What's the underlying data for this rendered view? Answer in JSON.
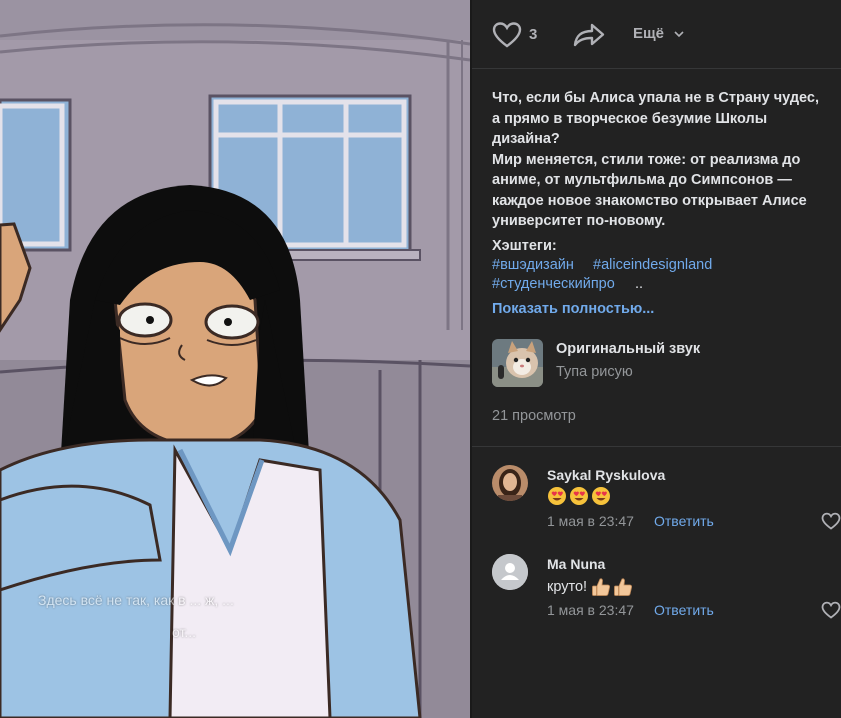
{
  "video": {
    "subtitle_line1": "Здесь всё не так, как в ... ж, ...",
    "subtitle_line2": "от..."
  },
  "actions": {
    "like_count": "3",
    "more_label": "Ещё",
    "icons": [
      "heart-outline-icon",
      "share-arrow-icon",
      "chevron-down-icon"
    ]
  },
  "post": {
    "description": [
      "Что, если бы Алиса упала не в Страну чудес,",
      "а прямо в творческое безумие Школы",
      "дизайна?",
      "Мир меняется, стили тоже: от реализма до",
      "аниме, от мультфильма до Симпсонов —",
      "каждое новое знакомство открывает Алисе",
      "университет по-новому."
    ],
    "hashtags_label": "Хэштеги:",
    "hashtags": [
      "#вшэдизайн",
      "#aliceindesignland",
      "#студенческийпро"
    ],
    "hashtags_ellipsis": "..",
    "show_more": "Показать полностью..."
  },
  "sound": {
    "title": "Оригинальный звук",
    "author": "Тупа рисую"
  },
  "views": "21 просмотр",
  "comments": [
    {
      "author": "Saykal Ryskulova",
      "text": "",
      "emoji_count": 3,
      "date": "1 мая в 23:47",
      "reply_label": "Ответить"
    },
    {
      "author": "Ma Nuna",
      "text": "круто!",
      "emoji_count": 2,
      "date": "1 мая в 23:47",
      "reply_label": "Ответить"
    }
  ],
  "colors": {
    "background": "#222222",
    "text": "#e1e3e6",
    "muted": "#939699",
    "link": "#71aaeb"
  }
}
